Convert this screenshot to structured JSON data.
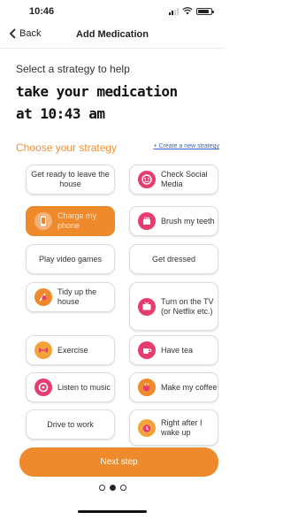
{
  "status": {
    "time": "10:46"
  },
  "nav": {
    "back_label": "Back",
    "title": "Add Medication"
  },
  "intro": {
    "prompt": "Select a strategy to help",
    "line1": "take your medication",
    "line2": "at 10:43 am"
  },
  "section": {
    "title": "Choose your strategy",
    "create_link": "+ Create a new strategy"
  },
  "strategies": [
    {
      "label": "Get ready to leave the house",
      "icon": "",
      "selected": false
    },
    {
      "label": "Check Social Media",
      "icon": "social-media-icon",
      "selected": false
    },
    {
      "label": "Charge my phone",
      "icon": "phone-icon",
      "selected": true
    },
    {
      "label": "Brush my teeth",
      "icon": "toothbrush-icon",
      "selected": false
    },
    {
      "label": "Play video games",
      "icon": "",
      "selected": false
    },
    {
      "label": "Get dressed",
      "icon": "",
      "selected": false
    },
    {
      "label": "Tidy up the house",
      "icon": "tidy-icon",
      "selected": false
    },
    {
      "label": "Turn on the TV (or Netflix etc.)",
      "icon": "tv-icon",
      "selected": false
    },
    {
      "label": "Exercise",
      "icon": "dumbbell-icon",
      "selected": false
    },
    {
      "label": "Have tea",
      "icon": "tea-icon",
      "selected": false
    },
    {
      "label": "Listen to music",
      "icon": "music-icon",
      "selected": false
    },
    {
      "label": "Make my coffee",
      "icon": "coffee-icon",
      "selected": false
    },
    {
      "label": "Drive to work",
      "icon": "",
      "selected": false
    },
    {
      "label": "Right after I wake up",
      "icon": "alarm-icon",
      "selected": false
    }
  ],
  "next_button": "Next step",
  "pager": {
    "total": 3,
    "current": 2
  },
  "colors": {
    "accent": "#ee8a2b",
    "heading_orange": "#ee9036",
    "link": "#3366cc",
    "icon_pink": "#e63c70"
  }
}
